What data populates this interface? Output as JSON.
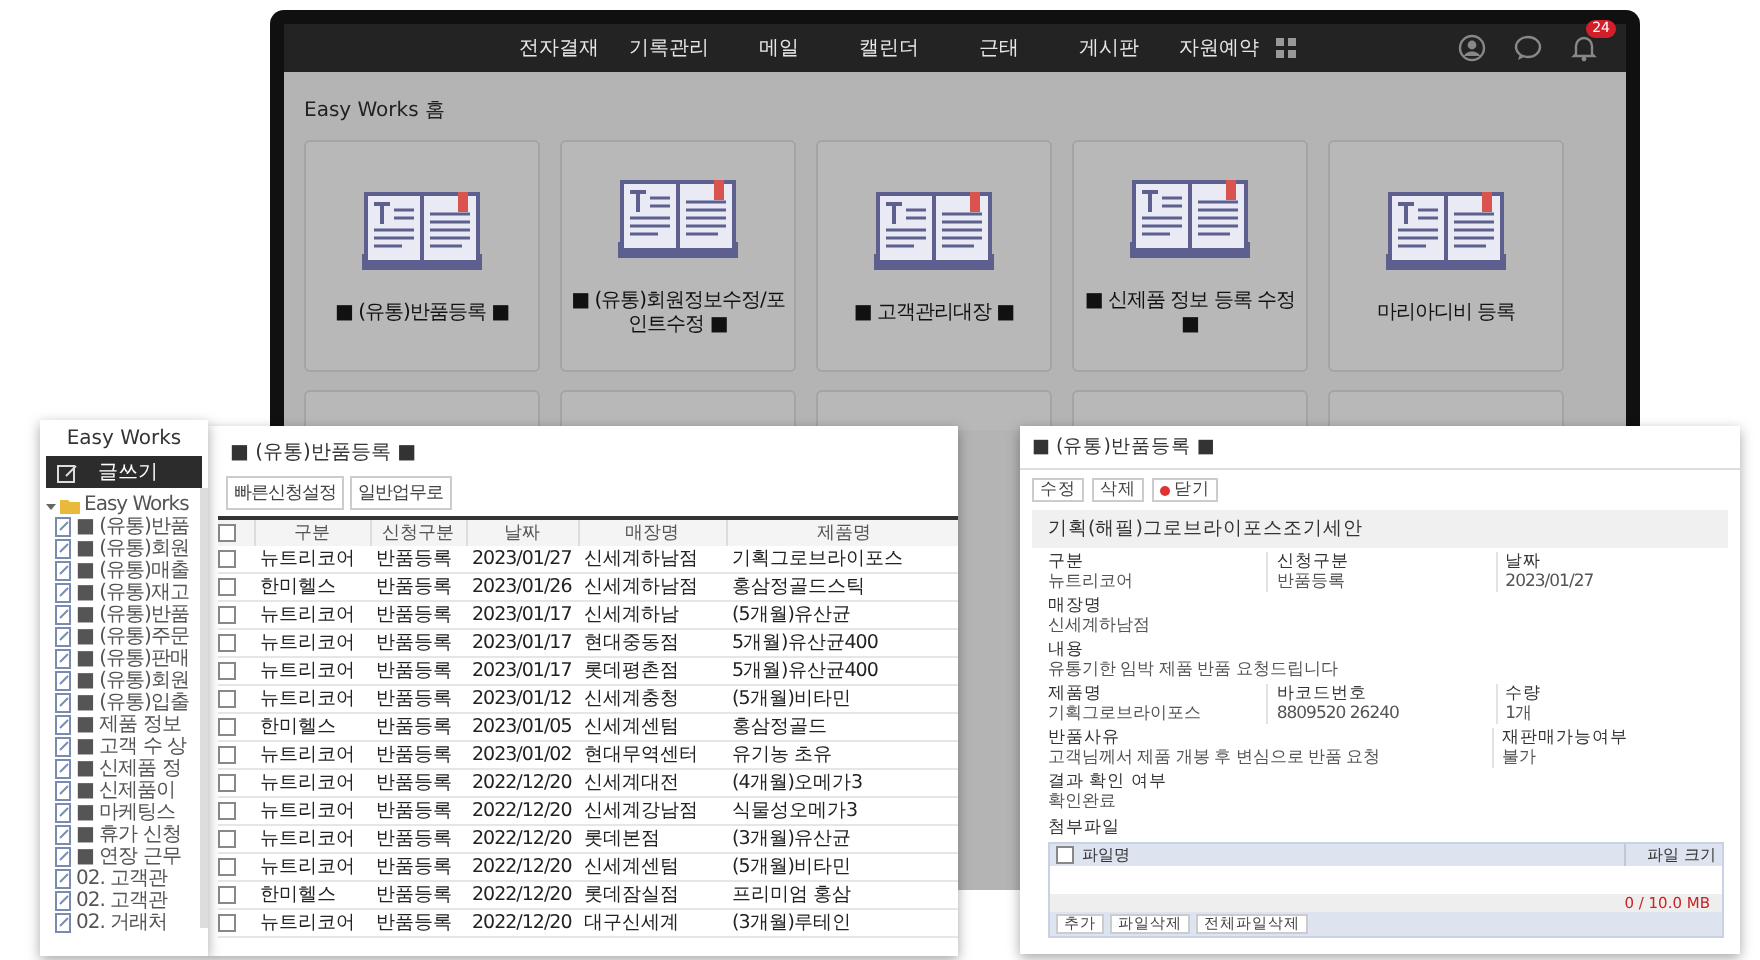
{
  "nav": {
    "items": [
      "전자결재",
      "기록관리",
      "메일",
      "캘린더",
      "근태",
      "게시판",
      "자원예약"
    ],
    "badge": "24"
  },
  "home": {
    "title": "Easy Works 홈",
    "cards": [
      {
        "label": "■ (유통)반품등록 ■"
      },
      {
        "label": "■ (유통)회원정보수정/포인트수정 ■"
      },
      {
        "label": "■ 고객관리대장 ■"
      },
      {
        "label": "■ 신제품 정보 등록 수정 ■"
      },
      {
        "label": "마리아디비 등록"
      }
    ]
  },
  "sidebar": {
    "title": "Easy Works",
    "write_button": "글쓰기",
    "tree": [
      {
        "label": "Easy Works",
        "expanded": true,
        "children": [
          {
            "label": "■ (유통)반품"
          },
          {
            "label": "■ (유통)회원"
          },
          {
            "label": "■ (유통)매출"
          },
          {
            "label": "■ (유통)재고"
          },
          {
            "label": "■ (유통)반품"
          },
          {
            "label": "■ (유통)주문"
          },
          {
            "label": "■ (유통)판매"
          },
          {
            "label": "■ (유통)회원"
          },
          {
            "label": "■ (유통)입출"
          },
          {
            "label": "■ 제품 정보"
          },
          {
            "label": "■ 고객 수 상"
          },
          {
            "label": "■ 신제품 정"
          },
          {
            "label": "■ 신제품이"
          },
          {
            "label": "■ 마케팅스"
          },
          {
            "label": "■ 휴가 신청"
          },
          {
            "label": "■ 연장 근무"
          },
          {
            "label": "02. 고객관"
          },
          {
            "label": "02. 고객관"
          },
          {
            "label": "02. 거래처"
          }
        ]
      }
    ]
  },
  "list": {
    "title": "■ (유통)반품등록 ■",
    "buttons": [
      "빠른신청설정",
      "일반업무로"
    ],
    "all_checked": false,
    "columns": [
      "구분",
      "신청구분",
      "날짜",
      "매장명",
      "제품명"
    ],
    "rows": [
      {
        "checked": false,
        "cells": [
          "뉴트리코어",
          "반품등록",
          "2023/01/27",
          "신세계하남점",
          "기획그로브라이포스"
        ]
      },
      {
        "checked": false,
        "cells": [
          "한미헬스",
          "반품등록",
          "2023/01/26",
          "신세계하남점",
          "홍삼정골드스틱"
        ]
      },
      {
        "checked": false,
        "cells": [
          "뉴트리코어",
          "반품등록",
          "2023/01/17",
          "신세계하남",
          "(5개월)유산균"
        ]
      },
      {
        "checked": false,
        "cells": [
          "뉴트리코어",
          "반품등록",
          "2023/01/17",
          "현대중동점",
          "5개월)유산균400"
        ]
      },
      {
        "checked": false,
        "cells": [
          "뉴트리코어",
          "반품등록",
          "2023/01/17",
          "롯데평촌점",
          "5개월)유산균400"
        ]
      },
      {
        "checked": false,
        "cells": [
          "뉴트리코어",
          "반품등록",
          "2023/01/12",
          "신세계충청",
          "(5개월)비타민"
        ]
      },
      {
        "checked": false,
        "cells": [
          "한미헬스",
          "반품등록",
          "2023/01/05",
          "신세계센텀",
          "홍삼정골드"
        ]
      },
      {
        "checked": false,
        "cells": [
          "뉴트리코어",
          "반품등록",
          "2023/01/02",
          "현대무역센터",
          "유기농 초유"
        ]
      },
      {
        "checked": false,
        "cells": [
          "뉴트리코어",
          "반품등록",
          "2022/12/20",
          "신세계대전",
          "(4개월)오메가3"
        ]
      },
      {
        "checked": false,
        "cells": [
          "뉴트리코어",
          "반품등록",
          "2022/12/20",
          "신세계강남점",
          "식물성오메가3"
        ]
      },
      {
        "checked": false,
        "cells": [
          "뉴트리코어",
          "반품등록",
          "2022/12/20",
          "롯데본점",
          "(3개월)유산균"
        ]
      },
      {
        "checked": false,
        "cells": [
          "뉴트리코어",
          "반품등록",
          "2022/12/20",
          "신세계센텀",
          "(5개월)비타민"
        ]
      },
      {
        "checked": false,
        "cells": [
          "한미헬스",
          "반품등록",
          "2022/12/20",
          "롯데잠실점",
          "프리미엄 홍삼"
        ]
      },
      {
        "checked": false,
        "cells": [
          "뉴트리코어",
          "반품등록",
          "2022/12/20",
          "대구신세계",
          "(3개월)루테인"
        ]
      }
    ]
  },
  "detail": {
    "title": "■ (유통)반품등록 ■",
    "buttons": [
      {
        "label": "수정",
        "kind": "plain"
      },
      {
        "label": "삭제",
        "kind": "plain"
      },
      {
        "label": "닫기",
        "kind": "close"
      }
    ],
    "subject": "기획(해필)그로브라이포스조기세안",
    "field_rows": [
      [
        {
          "label": "구분",
          "value": "뉴트리코어"
        },
        {
          "label": "신청구분",
          "value": "반품등록"
        },
        {
          "label": "날짜",
          "value": "2023/01/27"
        }
      ],
      [
        {
          "label": "매장명",
          "value": "신세계하남점"
        }
      ],
      [
        {
          "label": "내용",
          "value": "유통기한 임박 제품 반품 요청드립니다"
        }
      ],
      [
        {
          "label": "제품명",
          "value": "기획그로브라이포스"
        },
        {
          "label": "바코드번호",
          "value": "8809520 26240"
        },
        {
          "label": "수량",
          "value": "1개"
        }
      ],
      [
        {
          "label": "반품사유",
          "value": "고객님께서 제품 개봉 후 변심으로 반품 요청"
        },
        {
          "label": "재판매가능여부",
          "value": "불가"
        }
      ],
      [
        {
          "label": "결과 확인 여부",
          "value": "확인완료"
        }
      ]
    ],
    "attachments": {
      "label": "첨부파일",
      "columns": [
        "파일명",
        "파일 크기"
      ],
      "checked": false,
      "usage": "0 / 10.0 MB",
      "buttons": [
        "추가",
        "파일삭제",
        "전체파일삭제"
      ]
    }
  }
}
